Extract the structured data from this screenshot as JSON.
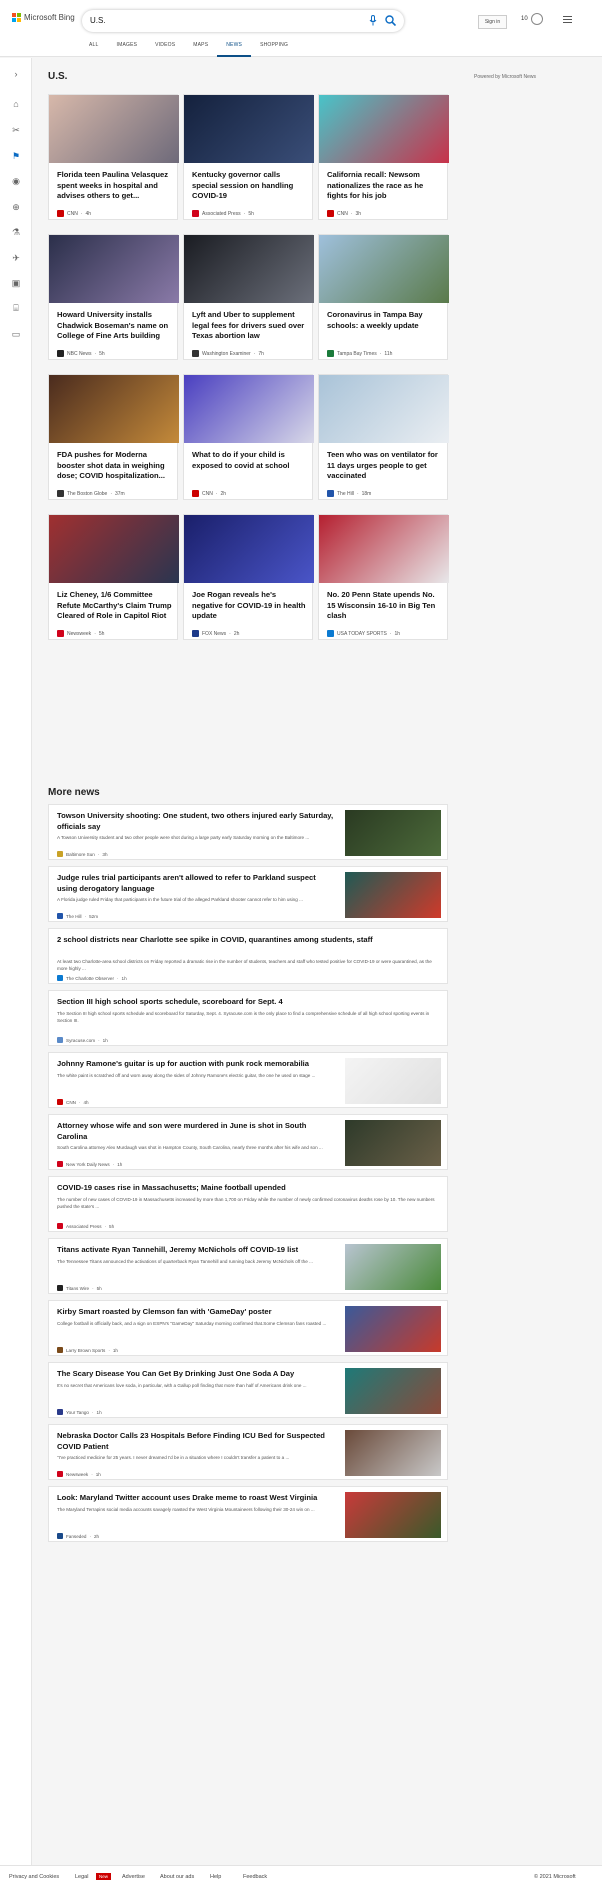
{
  "header": {
    "logo_text": "Microsoft Bing",
    "search_value": "U.S.",
    "signin": "Sign in",
    "rewards_count": "10",
    "scopes": [
      {
        "label": "ALL"
      },
      {
        "label": "IMAGES"
      },
      {
        "label": "VIDEOS"
      },
      {
        "label": "MAPS"
      },
      {
        "label": "NEWS",
        "active": true
      },
      {
        "label": "SHOPPING"
      }
    ]
  },
  "sidebar": {
    "icons": [
      "chevron-right-icon",
      "home-icon",
      "sports-icon",
      "flag-icon",
      "location-icon",
      "world-icon",
      "science-icon",
      "rocket-icon",
      "entertainment-icon",
      "money-icon",
      "card-icon"
    ]
  },
  "section": {
    "title": "U.S.",
    "powered": "Powered by Microsoft News"
  },
  "cards": [
    {
      "title": "Florida teen Paulina Velasquez spent weeks in hospital and advises others to get...",
      "source": "CNN",
      "time": "4h",
      "logo_color": "#cc0000",
      "img": [
        "#d7b8aa",
        "#6e6a7a"
      ]
    },
    {
      "title": "Kentucky governor calls special session on handling COVID-19",
      "source": "Associated Press",
      "time": "5h",
      "logo_color": "#d0021b",
      "img": [
        "#14213d",
        "#3a4e78"
      ]
    },
    {
      "title": "California recall: Newsom nationalizes the race as he fights for his job",
      "source": "CNN",
      "time": "3h",
      "logo_color": "#cc0000",
      "img": [
        "#48c4c9",
        "#c8324a"
      ]
    },
    {
      "title": "Howard University installs Chadwick Boseman's name on College of Fine Arts building",
      "source": "NBC News",
      "time": "5h",
      "logo_color": "#222222",
      "img": [
        "#2b2f4a",
        "#8a7aa8"
      ]
    },
    {
      "title": "Lyft and Uber to supplement legal fees for drivers sued over Texas abortion law",
      "source": "Washington Examiner",
      "time": "7h",
      "logo_color": "#333333",
      "img": [
        "#1a1c22",
        "#6b6f7a"
      ]
    },
    {
      "title": "Coronavirus in Tampa Bay schools: a weekly update",
      "source": "Tampa Bay Times",
      "time": "11h",
      "logo_color": "#1a7a3a",
      "img": [
        "#9fc0dc",
        "#5a7a4a"
      ]
    },
    {
      "title": "FDA pushes for Moderna booster shot data in weighing dose; COVID hospitalization...",
      "source": "The Boston Globe",
      "time": "37m",
      "logo_color": "#333333",
      "img": [
        "#4a2b1e",
        "#c48a3a"
      ]
    },
    {
      "title": "What to do if your child is exposed to covid at school",
      "source": "CNN",
      "time": "2h",
      "logo_color": "#cc0000",
      "img": [
        "#4a3fc0",
        "#d8d8e8"
      ]
    },
    {
      "title": "Teen who was on ventilator for 11 days urges people to get vaccinated",
      "source": "The Hill",
      "time": "18m",
      "logo_color": "#2255aa",
      "img": [
        "#a9c3d8",
        "#eaeef2"
      ]
    },
    {
      "title": "Liz Cheney, 1/6 Committee Refute McCarthy's Claim Trump Cleared of Role in Capitol Riot",
      "source": "Newsweek",
      "time": "5h",
      "logo_color": "#d0021b",
      "img": [
        "#a03030",
        "#2a3550"
      ]
    },
    {
      "title": "Joe Rogan reveals he's negative for COVID-19 in health update",
      "source": "FOX News",
      "time": "2h",
      "logo_color": "#1d3a8a",
      "img": [
        "#1a1f6a",
        "#4a55c8"
      ]
    },
    {
      "title": "No. 20 Penn State upends No. 15 Wisconsin 16-10 in Big Ten clash",
      "source": "USA TODAY SPORTS",
      "time": "1h",
      "logo_color": "#0b7ad1",
      "img": [
        "#b52030",
        "#e8e8ea"
      ]
    }
  ],
  "more": {
    "title": "More news",
    "items": [
      {
        "title": "Towson University shooting: One student, two others injured early Saturday, officials say",
        "snippet": "A Towson University student and two other people were shot during a large party early Saturday morning on the Baltimore ...",
        "source": "Baltimore Sun",
        "time": "3h",
        "logo_color": "#c9a227",
        "img": [
          "#2a3a22",
          "#4c6a3a"
        ]
      },
      {
        "title": "Judge rules trial participants aren't allowed to refer to Parkland suspect using derogatory language",
        "snippet": "A Florida judge ruled Friday that participants in the future trial of the alleged Parkland shooter cannot refer to him using ...",
        "source": "The Hill",
        "time": "52m",
        "logo_color": "#2255aa",
        "img": [
          "#1f5a55",
          "#d03a2a"
        ]
      },
      {
        "title": "2 school districts near Charlotte see spike in COVID, quarantines among students, staff",
        "snippet": "At least two Charlotte-area school districts on Friday reported a dramatic rise in the number of students, teachers and staff who tested positive for COVID-19 or were quarantined, as the more highly ...",
        "source": "The Charlotte Observer",
        "time": "1h",
        "logo_color": "#0b7ad1",
        "img": null
      },
      {
        "title": "Section III high school sports schedule, scoreboard for Sept. 4",
        "snippet": "The Section III high school sports schedule and scoreboard for Saturday, Sept. 4. Syracuse.com is the only place to find a comprehensive schedule of all high school sporting events in Section III.",
        "source": "Syracuse.com",
        "time": "1h",
        "logo_color": "#5a8ac8",
        "img": null
      },
      {
        "title": "Johnny Ramone's guitar is up for auction with punk rock memorabilia",
        "snippet": "The white paint is scratched off and worn away along the sides of Johnny Ramone's electric guitar, the one he used on stage ...",
        "source": "CNN",
        "time": "4h",
        "logo_color": "#cc0000",
        "img": [
          "#f4f4f4",
          "#e0e0e0"
        ]
      },
      {
        "title": "Attorney whose wife and son were murdered in June is shot in South Carolina",
        "snippet": "South Carolina attorney Alex Murdaugh was shot in Hampton County, South Carolina, nearly three months after his wife and son ...",
        "source": "New York Daily News",
        "time": "1h",
        "logo_color": "#d0021b",
        "img": [
          "#2e3a2a",
          "#6a6048"
        ]
      },
      {
        "title": "COVID-19 cases rise in Massachusetts; Maine football upended",
        "snippet": "The number of new cases of COVID-19 in Massachusetts increased by more than 1,700 on Friday while the number of newly confirmed coronavirus deaths rose by 10. The new numbers pushed the state's ...",
        "source": "Associated Press",
        "time": "5h",
        "logo_color": "#d0021b",
        "img": null
      },
      {
        "title": "Titans activate Ryan Tannehill, Jeremy McNichols off COVID-19 list",
        "snippet": "The Tennessee Titans announced the activations of quarterback Ryan Tannehill and running back Jeremy McNichols off the ...",
        "source": "Titans Wire",
        "time": "5h",
        "logo_color": "#222222",
        "img": [
          "#b8c4d0",
          "#4a8a3a"
        ]
      },
      {
        "title": "Kirby Smart roasted by Clemson fan with 'GameDay' poster",
        "snippet": "College football is officially back, and a sign on ESPN's \"GameDay\" Saturday morning confirmed that.Some Clemson fans roasted ...",
        "source": "Larry Brown Sports",
        "time": "1h",
        "logo_color": "#7a4a1a",
        "img": [
          "#3a5a9a",
          "#c83a2a"
        ]
      },
      {
        "title": "The Scary Disease You Can Get By Drinking Just One Soda A Day",
        "snippet": "It's no secret that Americans love soda, in particular, with a Gallup poll finding that more than half of Americans drink one ...",
        "source": "Your Tango",
        "time": "1h",
        "logo_color": "#2a3a8a",
        "img": [
          "#1e7a78",
          "#8a4a3a"
        ]
      },
      {
        "title": "Nebraska Doctor Calls 23 Hospitals Before Finding ICU Bed for Suspected COVID Patient",
        "snippet": "\"I've practiced medicine for 25 years. I never dreamed I'd be in a situation where I couldn't transfer a patient to a ...",
        "source": "Newsweek",
        "time": "1h",
        "logo_color": "#d0021b",
        "img": [
          "#6a4a3a",
          "#c8c8c8"
        ]
      },
      {
        "title": "Look: Maryland Twitter account uses Drake meme to roast West Virginia",
        "snippet": "The Maryland Terrapins social media accounts savagely roasted the West Virginia Mountaineers following their 30-24 win on ...",
        "source": "Fanseded",
        "time": "2h",
        "logo_color": "#1a4a8a",
        "img": [
          "#c83a3a",
          "#3a5a2a"
        ]
      }
    ]
  },
  "footer": {
    "links": [
      "Privacy and Cookies",
      "Legal",
      "Advertise",
      "About our ads",
      "Help",
      "Feedback"
    ],
    "new_badge": "New",
    "copyright": "© 2021 Microsoft"
  }
}
